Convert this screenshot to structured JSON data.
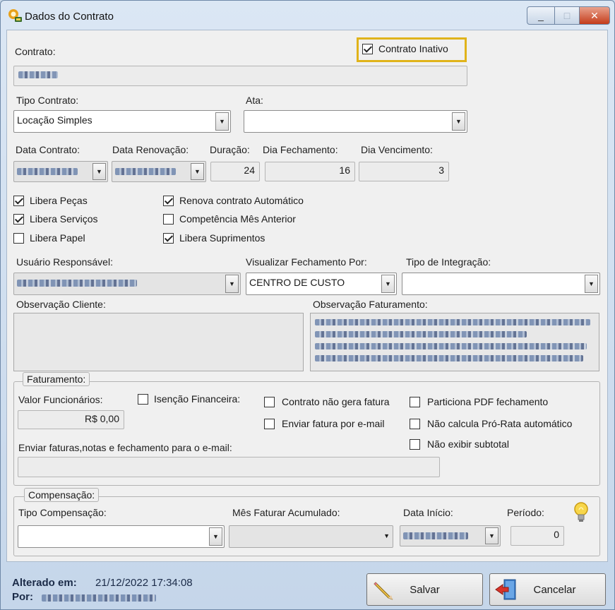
{
  "window": {
    "title": "Dados do Contrato",
    "controls": {
      "minimize": "_",
      "maximize": "□",
      "close": "✕"
    }
  },
  "contrato": {
    "label": "Contrato:",
    "inativo_label": "Contrato Inativo",
    "inativo_checked": true
  },
  "tipo_contrato": {
    "label": "Tipo Contrato:",
    "value": "Locação Simples"
  },
  "ata": {
    "label": "Ata:",
    "value": ""
  },
  "datas": {
    "data_contrato_label": "Data Contrato:",
    "data_renovacao_label": "Data Renovação:",
    "duracao_label": "Duração:",
    "duracao_value": "24",
    "dia_fechamento_label": "Dia Fechamento:",
    "dia_fechamento_value": "16",
    "dia_vencimento_label": "Dia Vencimento:",
    "dia_vencimento_value": "3"
  },
  "checks": {
    "libera_pecas": {
      "label": "Libera Peças",
      "checked": true
    },
    "libera_servicos": {
      "label": "Libera Serviços",
      "checked": true
    },
    "libera_papel": {
      "label": "Libera Papel",
      "checked": false
    },
    "renova_automatico": {
      "label": "Renova contrato Automático",
      "checked": true
    },
    "competencia_mes_anterior": {
      "label": "Competência Mês Anterior",
      "checked": false
    },
    "libera_suprimentos": {
      "label": "Libera Suprimentos",
      "checked": true
    }
  },
  "usuario_responsavel": {
    "label": "Usuário Responsável:"
  },
  "visualizar_fechamento": {
    "label": "Visualizar Fechamento Por:",
    "value": "CENTRO DE CUSTO"
  },
  "tipo_integracao": {
    "label": "Tipo de Integração:",
    "value": ""
  },
  "observacao_cliente": {
    "label": "Observação Cliente:"
  },
  "observacao_faturamento": {
    "label": "Observação Faturamento:"
  },
  "faturamento": {
    "title": "Faturamento:",
    "valor_funcionarios_label": "Valor Funcionários:",
    "valor_funcionarios_value": "R$ 0,00",
    "isencao_financeira": {
      "label": "Isenção Financeira:",
      "checked": false
    },
    "nao_gera_fatura": {
      "label": "Contrato não gera fatura",
      "checked": false
    },
    "enviar_email": {
      "label": "Enviar fatura por e-mail",
      "checked": false
    },
    "particiona_pdf": {
      "label": "Particiona PDF fechamento",
      "checked": false
    },
    "nao_calcula_prorata": {
      "label": "Não calcula Pró-Rata automático",
      "checked": false
    },
    "nao_exibir_subtotal": {
      "label": "Não exibir subtotal",
      "checked": false
    },
    "email_label": "Enviar faturas,notas e fechamento para o e-mail:",
    "email_value": ""
  },
  "compensacao": {
    "title": "Compensação:",
    "tipo_label": "Tipo Compensação:",
    "tipo_value": "",
    "mes_faturar_label": "Mês Faturar Acumulado:",
    "mes_faturar_value": "",
    "data_inicio_label": "Data Início:",
    "periodo_label": "Período:",
    "periodo_value": "0"
  },
  "footer": {
    "alterado_em_label": "Alterado em:",
    "alterado_em_value": "21/12/2022 17:34:08",
    "por_label": "Por:"
  },
  "buttons": {
    "salvar": "Salvar",
    "cancelar": "Cancelar"
  },
  "icons": {
    "app": "app-logo-icon",
    "lamp": "lightbulb-icon",
    "salvar": "pencil-icon",
    "cancelar": "exit-door-icon"
  },
  "colors": {
    "highlight": "#e0b31a",
    "close_button": "#c43c1b"
  }
}
